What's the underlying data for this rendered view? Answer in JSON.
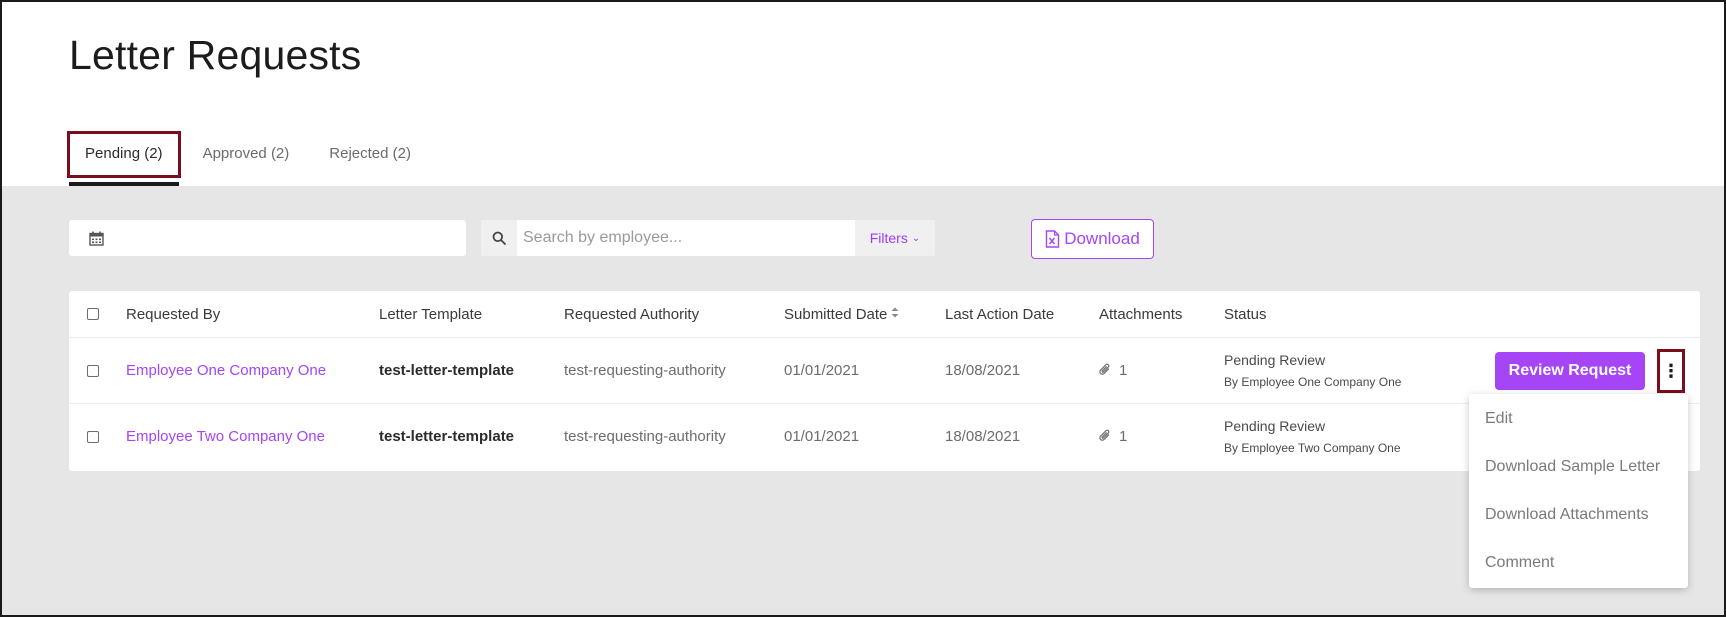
{
  "page": {
    "title": "Letter Requests"
  },
  "tabs": [
    {
      "label": "Pending (2)",
      "active": true
    },
    {
      "label": "Approved (2)",
      "active": false
    },
    {
      "label": "Rejected (2)",
      "active": false
    }
  ],
  "toolbar": {
    "date_icon": "calendar-icon",
    "search_placeholder": "Search by employee...",
    "filters_label": "Filters",
    "download_label": "Download",
    "download_icon": "excel-file-icon"
  },
  "table": {
    "headers": {
      "requested_by": "Requested By",
      "letter_template": "Letter Template",
      "requested_authority": "Requested Authority",
      "submitted_date": "Submitted Date",
      "last_action_date": "Last Action Date",
      "attachments": "Attachments",
      "status": "Status"
    },
    "rows": [
      {
        "requested_by": "Employee One Company One",
        "letter_template": "test-letter-template",
        "requested_authority": "test-requesting-authority",
        "submitted_date": "01/01/2021",
        "last_action_date": "18/08/2021",
        "attachments": "1",
        "status": "Pending Review",
        "status_by": "By Employee One Company One",
        "action_label": "Review Request"
      },
      {
        "requested_by": "Employee Two Company One",
        "letter_template": "test-letter-template",
        "requested_authority": "test-requesting-authority",
        "submitted_date": "01/01/2021",
        "last_action_date": "18/08/2021",
        "attachments": "1",
        "status": "Pending Review",
        "status_by": "By Employee Two Company One"
      }
    ]
  },
  "menu": {
    "items": [
      "Edit",
      "Download Sample Letter",
      "Download Attachments",
      "Comment"
    ]
  },
  "colors": {
    "accent": "#a545f5",
    "highlight_border": "#7a0e1c",
    "content_bg": "#e6e6e6"
  }
}
